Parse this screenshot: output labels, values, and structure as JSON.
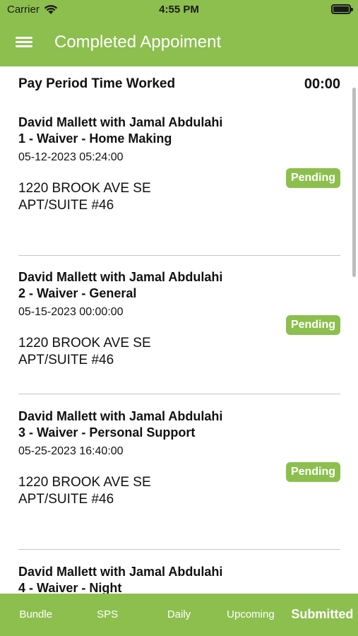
{
  "status_bar": {
    "carrier": "Carrier",
    "time": "4:55 PM"
  },
  "header": {
    "title": "Completed Appoiment",
    "menu_icon": "hamburger-menu-icon"
  },
  "pay_period": {
    "label": "Pay Period Time Worked",
    "value": "00:00"
  },
  "appointments": [
    {
      "title": "David Mallett with Jamal Abdulahi 1 - Waiver - Home Making",
      "datetime": "05-12-2023 05:24:00",
      "address_line1": "1220 BROOK AVE SE",
      "address_line2": "APT/SUITE #46",
      "status": "Pending"
    },
    {
      "title": "David Mallett with Jamal Abdulahi 2 - Waiver - General",
      "datetime": "05-15-2023 00:00:00",
      "address_line1": "1220 BROOK AVE SE",
      "address_line2": "APT/SUITE #46",
      "status": "Pending"
    },
    {
      "title": "David Mallett with Jamal Abdulahi 3 - Waiver - Personal Support",
      "datetime": "05-25-2023 16:40:00",
      "address_line1": "1220 BROOK AVE SE",
      "address_line2": "APT/SUITE #46",
      "status": "Pending"
    },
    {
      "title": "David Mallett with Jamal Abdulahi 4 - Waiver - Night"
    }
  ],
  "tabs": [
    {
      "label": "Bundle",
      "active": false
    },
    {
      "label": "SPS",
      "active": false
    },
    {
      "label": "Daily",
      "active": false
    },
    {
      "label": "Upcoming",
      "active": false
    },
    {
      "label": "Submitted",
      "active": true
    }
  ],
  "colors": {
    "accent": "#8cbf4e",
    "divider": "#c8c8c8"
  }
}
